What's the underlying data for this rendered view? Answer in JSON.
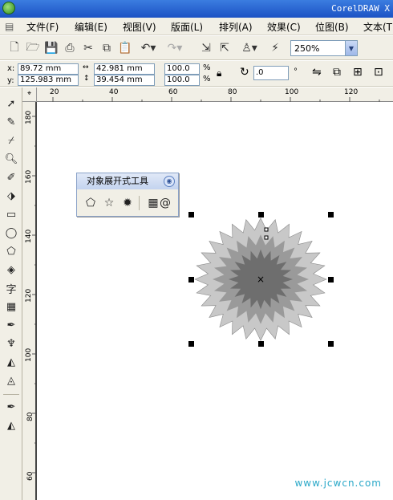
{
  "app": {
    "title": "CorelDRAW X"
  },
  "menu": [
    {
      "label": "文件(F)"
    },
    {
      "label": "编辑(E)"
    },
    {
      "label": "视图(V)"
    },
    {
      "label": "版面(L)"
    },
    {
      "label": "排列(A)"
    },
    {
      "label": "效果(C)"
    },
    {
      "label": "位图(B)"
    },
    {
      "label": "文本(T)"
    }
  ],
  "toolbar": {
    "zoom": "250%"
  },
  "properties": {
    "x_label": "x:",
    "y_label": "y:",
    "x": "89.72 mm",
    "y": "125.983 mm",
    "width": "42.981 mm",
    "height": "39.454 mm",
    "scale_w": "100.0",
    "scale_h": "100.0",
    "pct1": "%",
    "pct2": "%",
    "rotation": ".0",
    "degree": "°"
  },
  "ruler": {
    "h_ticks": [
      "20",
      "40",
      "60",
      "80",
      "100",
      "120"
    ],
    "v_ticks": [
      "180",
      "160",
      "140",
      "120",
      "100",
      "80",
      "60"
    ]
  },
  "flyout": {
    "title": "对象展开式工具"
  },
  "watermark": "www.jcwcn.com",
  "colors": {
    "title_bar": "#245edb",
    "chrome": "#f1efe6",
    "star_outer": "#c8c8c8",
    "star_mid": "#9a9a9a",
    "star_inner": "#6e6e6e"
  }
}
